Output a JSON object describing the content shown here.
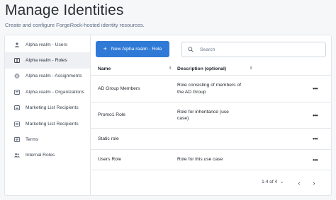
{
  "header": {
    "title": "Manage Identities",
    "subtitle": "Create and configure ForgeRock-hosted identity resources."
  },
  "sidebar": {
    "items": [
      {
        "label": "Alpha realm - Users",
        "icon": "user-icon",
        "active": false
      },
      {
        "label": "Alpha realm - Roles",
        "icon": "id-badge-icon",
        "active": true
      },
      {
        "label": "Alpha realm - Assignments",
        "icon": "assignment-icon",
        "active": false
      },
      {
        "label": "Alpha realm - Organizations",
        "icon": "organization-icon",
        "active": false
      },
      {
        "label": "Marketing List Recipients",
        "icon": "list-card-icon",
        "active": false
      },
      {
        "label": "Marketing List Recipients",
        "icon": "list-card-icon",
        "active": false
      },
      {
        "label": "Terms",
        "icon": "document-icon",
        "active": false
      },
      {
        "label": "Internal Roles",
        "icon": "group-icon",
        "active": false
      }
    ]
  },
  "toolbar": {
    "new_button_label": "New Alpha realm - Role",
    "search_placeholder": "Search"
  },
  "table": {
    "columns": [
      "Name",
      "Description (optional)"
    ],
    "rows": [
      {
        "name": "AD Group Members",
        "description": "Role consisting of members of the AD Group"
      },
      {
        "name": "Promo1 Role",
        "description": "Role for inheritance (use case)"
      },
      {
        "name": "Static role",
        "description": ""
      },
      {
        "name": "Users Role",
        "description": "Role for this use case"
      }
    ],
    "row_menu_label": "•••"
  },
  "pagination": {
    "range": "1-4 of 4",
    "prev": "‹",
    "next": "›"
  },
  "colors": {
    "accent": "#2f7ad6",
    "active_sidebar_bg": "#eef0f3",
    "page_bg": "#f6f7f9"
  }
}
